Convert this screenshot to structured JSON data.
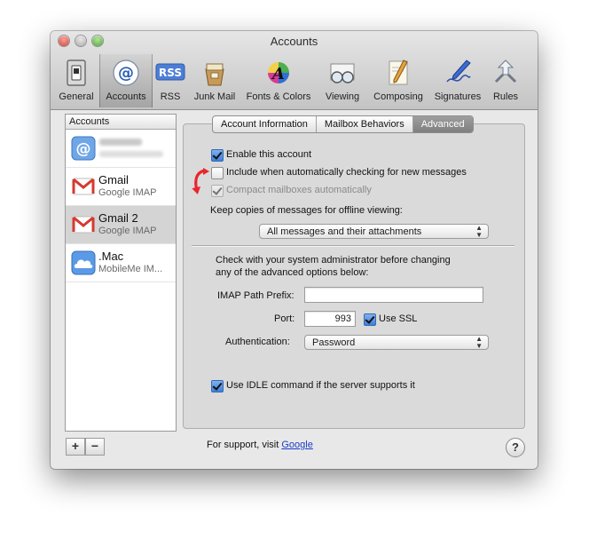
{
  "window": {
    "title": "Accounts"
  },
  "toolbar": [
    {
      "label": "General",
      "icon": "general-switch-icon"
    },
    {
      "label": "Accounts",
      "icon": "at-sign-icon",
      "selected": true
    },
    {
      "label": "RSS",
      "icon": "rss-badge-icon"
    },
    {
      "label": "Junk Mail",
      "icon": "junk-mail-bag-icon"
    },
    {
      "label": "Fonts & Colors",
      "icon": "fonts-colors-icon"
    },
    {
      "label": "Viewing",
      "icon": "viewing-glasses-icon"
    },
    {
      "label": "Composing",
      "icon": "composing-pencil-icon"
    },
    {
      "label": "Signatures",
      "icon": "signature-pen-icon"
    },
    {
      "label": "Rules",
      "icon": "rules-arrows-icon"
    }
  ],
  "sidebar": {
    "header": "Accounts",
    "accounts": [
      {
        "name": "",
        "type": "",
        "icon": "at-sign-icon",
        "blurred": true
      },
      {
        "name": "Gmail",
        "type": "Google IMAP",
        "icon": "gmail-icon"
      },
      {
        "name": "Gmail 2",
        "type": "Google IMAP",
        "icon": "gmail-icon",
        "selected": true
      },
      {
        "name": ".Mac",
        "type": "MobileMe IM...",
        "icon": "cloud-icon"
      }
    ],
    "add_label": "+",
    "remove_label": "−"
  },
  "tabs": [
    {
      "label": "Account Information"
    },
    {
      "label": "Mailbox Behaviors"
    },
    {
      "label": "Advanced",
      "active": true
    }
  ],
  "advanced": {
    "enable_account": {
      "label": "Enable this account",
      "checked": true
    },
    "include_auto_check": {
      "label": "Include when automatically checking for new messages",
      "checked": false
    },
    "compact_mailboxes": {
      "label": "Compact mailboxes automatically",
      "checked": true,
      "disabled": true
    },
    "keep_copies_label": "Keep copies of messages for offline viewing:",
    "keep_copies_value": "All messages and their attachments",
    "admin_note_line1": "Check with your system administrator before changing",
    "admin_note_line2": "any of the advanced options below:",
    "imap_prefix_label": "IMAP Path Prefix:",
    "imap_prefix_value": "",
    "port_label": "Port:",
    "port_value": "993",
    "use_ssl": {
      "label": "Use SSL",
      "checked": true
    },
    "auth_label": "Authentication:",
    "auth_value": "Password",
    "idle": {
      "label": "Use IDLE command if the server supports it",
      "checked": true
    }
  },
  "footer": {
    "support_text": "For support, visit",
    "support_link": "Google",
    "help_label": "?"
  },
  "colors": {
    "arrow": "#e8262b",
    "link": "#1a3cc9",
    "selected_tab": "#8a8a8a"
  }
}
